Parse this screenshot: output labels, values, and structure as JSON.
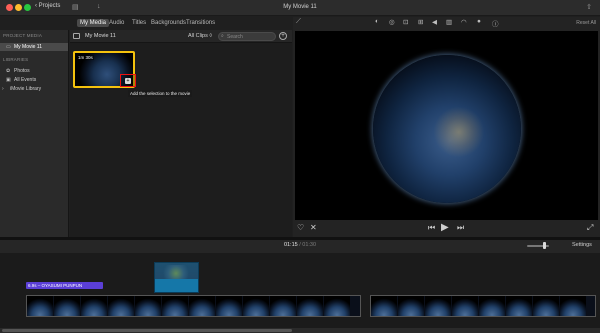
{
  "window": {
    "title": "My Movie 11",
    "projects_label": "Projects",
    "traffic_colors": [
      "#fe5f57",
      "#febc2e",
      "#28c840"
    ]
  },
  "browser_tabs": [
    {
      "label": "My Media",
      "active": true
    },
    {
      "label": "Audio",
      "active": false
    },
    {
      "label": "Titles",
      "active": false
    },
    {
      "label": "Backgrounds",
      "active": false
    },
    {
      "label": "Transitions",
      "active": false
    }
  ],
  "sidebar": {
    "project_media_header": "PROJECT MEDIA",
    "project_item": "My Movie 11",
    "libraries_header": "LIBRARIES",
    "items": [
      {
        "label": "Photos",
        "icon": "photos-icon"
      },
      {
        "label": "All Events",
        "icon": "events-icon"
      },
      {
        "label": "iMovie Library",
        "icon": "disclosure-icon"
      }
    ]
  },
  "browser": {
    "title": "My Movie 11",
    "filter": "All Clips ◊",
    "search_placeholder": "Search",
    "clip_duration": "1m 30s",
    "add_tooltip": "Add the selection to the movie",
    "selection_color": "#f4c20d"
  },
  "viewer": {
    "reset_all": "Reset All",
    "tools": [
      "color-balance-icon",
      "color-correction-icon",
      "crop-icon",
      "stabilization-icon",
      "volume-icon",
      "noise-reduction-icon",
      "speed-icon",
      "filter-icon",
      "info-icon"
    ]
  },
  "timeline": {
    "current_time": "01:15",
    "total_time": "/ 01:30",
    "settings": "Settings",
    "music_clip": "6.9s – OYASUMI PUNPUN",
    "music_color": "#5b3fd6"
  }
}
